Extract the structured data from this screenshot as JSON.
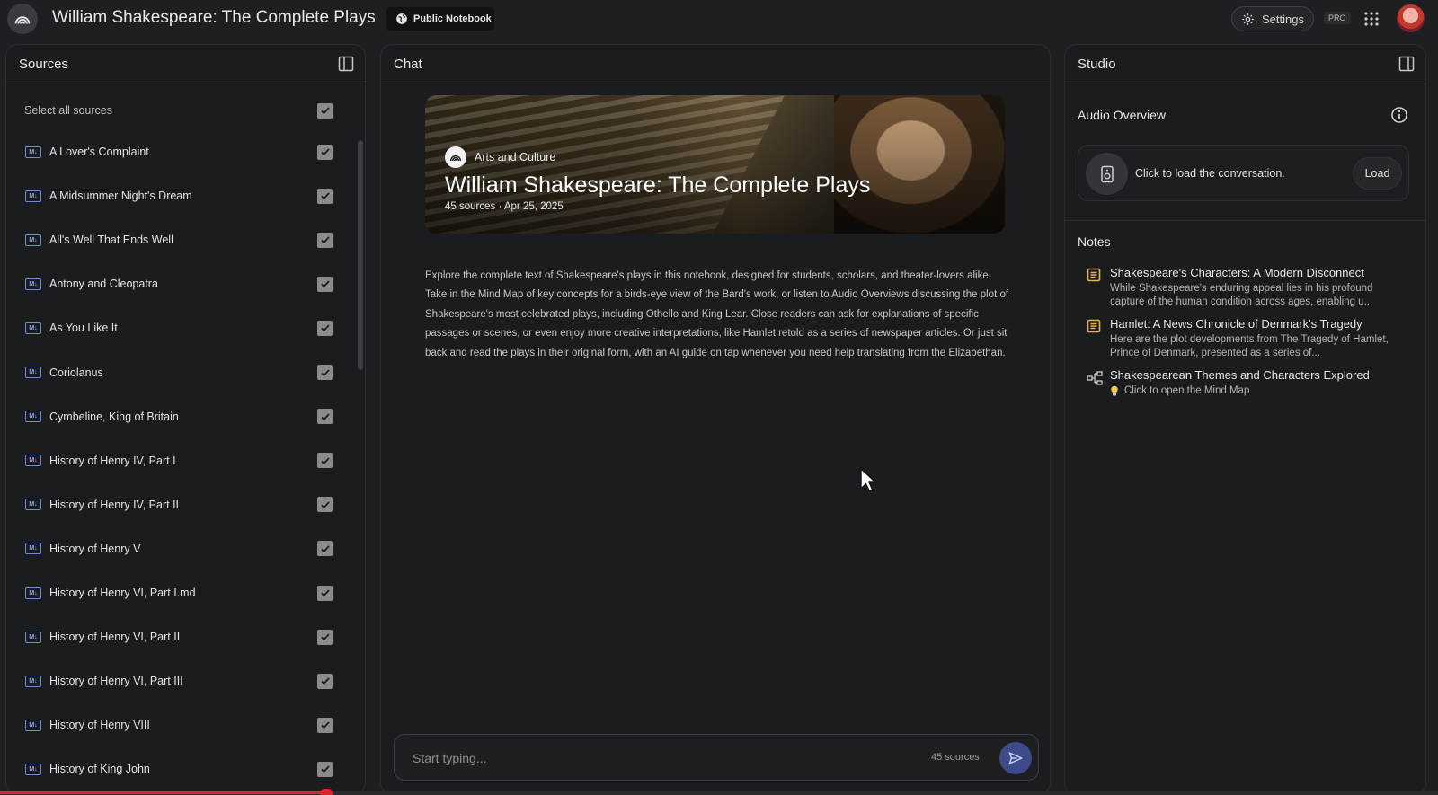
{
  "header": {
    "app_title": "William Shakespeare: The Complete Plays",
    "public_label": "Public Notebook",
    "settings_label": "Settings",
    "pro_label": "PRO"
  },
  "sources": {
    "title": "Sources",
    "select_all_label": "Select all sources",
    "items": [
      {
        "label": "A Lover's Complaint"
      },
      {
        "label": "A Midsummer Night's Dream"
      },
      {
        "label": "All's Well That Ends Well"
      },
      {
        "label": "Antony and Cleopatra"
      },
      {
        "label": "As You Like It"
      },
      {
        "label": "Coriolanus"
      },
      {
        "label": "Cymbeline, King of Britain"
      },
      {
        "label": "History of Henry IV, Part I"
      },
      {
        "label": "History of Henry IV, Part II"
      },
      {
        "label": "History of Henry V"
      },
      {
        "label": "History of Henry VI, Part I.md"
      },
      {
        "label": "History of Henry VI, Part II"
      },
      {
        "label": "History of Henry VI, Part III"
      },
      {
        "label": "History of Henry VIII"
      },
      {
        "label": "History of King John"
      }
    ],
    "icon_text": "M↓"
  },
  "chat": {
    "title": "Chat",
    "hero": {
      "category": "Arts and Culture",
      "title": "William Shakespeare: The Complete Plays",
      "meta": "45 sources · Apr 25, 2025"
    },
    "description": "Explore the complete text of Shakespeare's plays in this notebook, designed for students, scholars, and theater-lovers alike. Take in the Mind Map of key concepts for a birds-eye view of the Bard's work, or listen to Audio Overviews discussing the plot of Shakespeare's most celebrated plays, including Othello and King Lear. Close readers can ask for explanations of specific passages or scenes, or  even enjoy more creative interpretations, like Hamlet retold as a series of newspaper articles. Or just sit back and read the plays in their original form, with an AI guide on tap whenever you need help translating from the Elizabethan.",
    "composer": {
      "placeholder": "Start typing...",
      "source_count": "45 sources"
    }
  },
  "studio": {
    "title": "Studio",
    "audio_overview_title": "Audio Overview",
    "audio_card_text": "Click to load the conversation.",
    "load_label": "Load",
    "notes_title": "Notes",
    "notes": [
      {
        "title": "Shakespeare's Characters: A Modern Disconnect",
        "body": "While Shakespeare's enduring appeal lies in his profound capture of the human condition across ages, enabling u..."
      },
      {
        "title": "Hamlet: A News Chronicle of Denmark's Tragedy",
        "body": "Here are the plot developments from The Tragedy of Hamlet, Prince of Denmark, presented as a series of..."
      },
      {
        "title": "Shakespearean Themes and Characters Explored",
        "body": "Click to open the Mind Map"
      }
    ]
  },
  "colors": {
    "background": "#1e1f23",
    "panel": "#1b1c1f",
    "accent_send": "#3f4a8a",
    "source_icon": "#6c8fd6",
    "note_icon": "#e8b44a",
    "progress": "#e0242b"
  }
}
